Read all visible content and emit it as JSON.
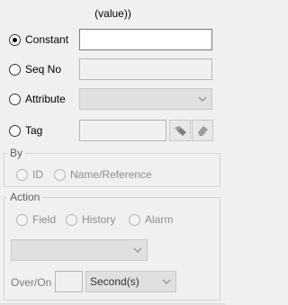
{
  "header": {
    "title": "(value))"
  },
  "source": {
    "constant": {
      "label": "Constant",
      "selected": true,
      "value": ""
    },
    "seq_no": {
      "label": "Seq No",
      "selected": false,
      "value": ""
    },
    "attribute": {
      "label": "Attribute",
      "selected": false,
      "value": ""
    },
    "tag": {
      "label": "Tag",
      "selected": false,
      "value": ""
    }
  },
  "by": {
    "legend": "By",
    "id_label": "ID",
    "name_ref_label": "Name/Reference"
  },
  "action": {
    "legend": "Action",
    "field_label": "Field",
    "history_label": "History",
    "alarm_label": "Alarm",
    "select_value": "",
    "over_on_label": "Over/On",
    "over_on_value": "",
    "unit_value": "Second(s)"
  },
  "icons": {
    "tag_browse": "tags-icon",
    "tag_erase": "eraser-icon"
  }
}
